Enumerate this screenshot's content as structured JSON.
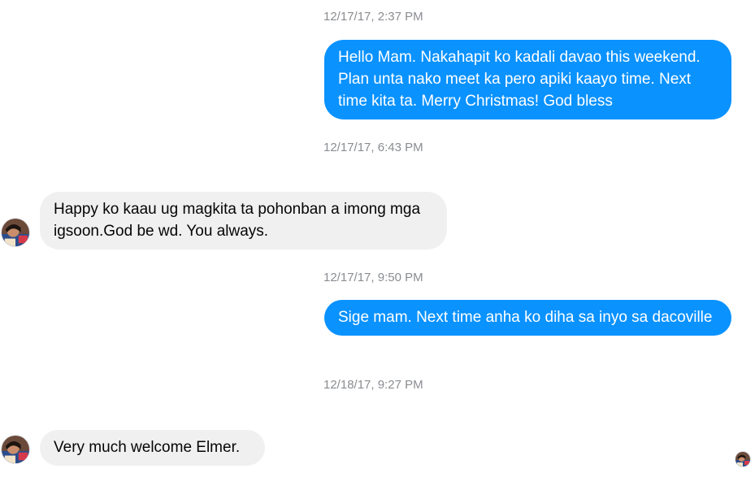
{
  "thread": {
    "messages": [
      {
        "timestamp": "12/17/17, 2:37 PM",
        "direction": "outgoing",
        "text": "Hello Mam. Nakahapit ko kadali davao this weekend. Plan unta nako meet ka pero apiki kaayo time. Next time kita ta. Merry Christmas! God bless"
      },
      {
        "timestamp": "12/17/17, 6:43 PM",
        "direction": "incoming",
        "text": "Happy ko kaau ug magkita ta pohonban a imong mga igsoon.God be wd. You always."
      },
      {
        "timestamp": "12/17/17, 9:50 PM",
        "direction": "outgoing",
        "text": "Sige mam. Next time anha ko diha sa inyo sa dacoville"
      },
      {
        "timestamp": "12/18/17, 9:27 PM",
        "direction": "incoming",
        "text": "Very much welcome Elmer."
      }
    ]
  },
  "colors": {
    "outgoing_bubble": "#0a92ff",
    "incoming_bubble": "#f0f0f0",
    "timestamp_text": "#8a8d91"
  },
  "icons": {
    "contact_avatar": "contact-avatar-icon",
    "seen_avatar": "seen-avatar-icon"
  }
}
